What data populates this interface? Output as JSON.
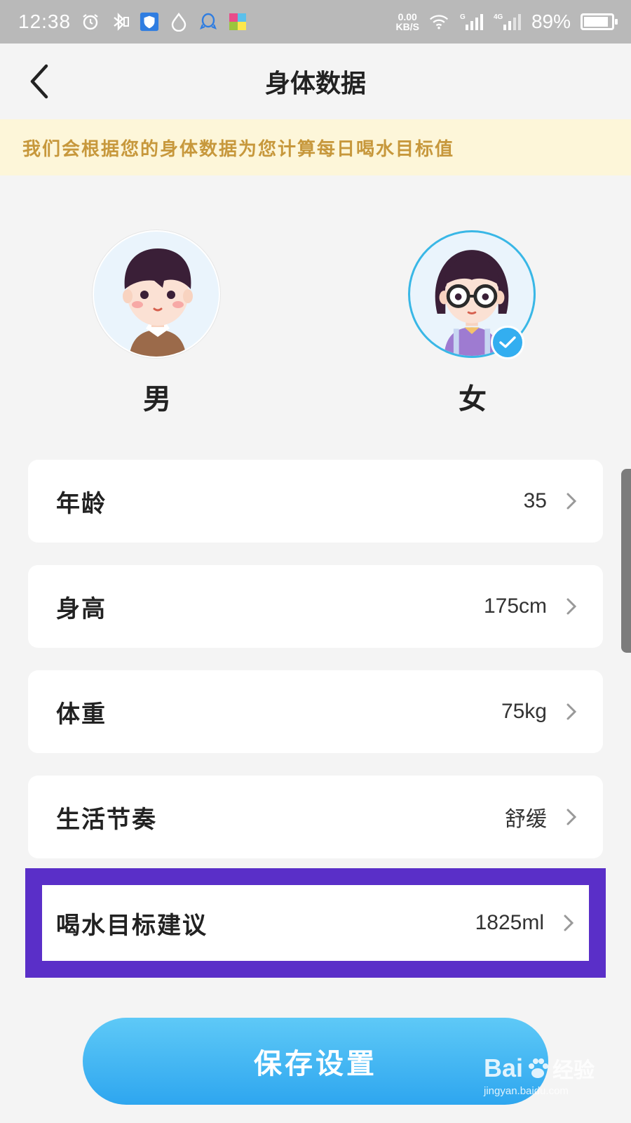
{
  "status_bar": {
    "time": "12:38",
    "net_speed_value": "0.00",
    "net_speed_unit": "KB/S",
    "signal1_label": "G",
    "signal2_label": "4G",
    "battery_text": "89%",
    "battery_level": 0.89
  },
  "header": {
    "title": "身体数据"
  },
  "notice": {
    "text": "我们会根据您的身体数据为您计算每日喝水目标值"
  },
  "gender": {
    "male_label": "男",
    "female_label": "女",
    "selected": "female"
  },
  "rows": [
    {
      "label": "年龄",
      "value": "35"
    },
    {
      "label": "身高",
      "value": "175cm"
    },
    {
      "label": "体重",
      "value": "75kg"
    },
    {
      "label": "生活节奏",
      "value": "舒缓"
    },
    {
      "label": "喝水目标建议",
      "value": "1825ml"
    }
  ],
  "save_button": {
    "label": "保存设置"
  },
  "watermark": {
    "logo_left": "Bai",
    "logo_right": "经验",
    "url": "jingyan.baidu.com"
  },
  "colors": {
    "accent": "#2ea6ef",
    "notice_bg": "#fdf6d9",
    "notice_text": "#c7983c",
    "highlight": "#5a2fc8"
  }
}
